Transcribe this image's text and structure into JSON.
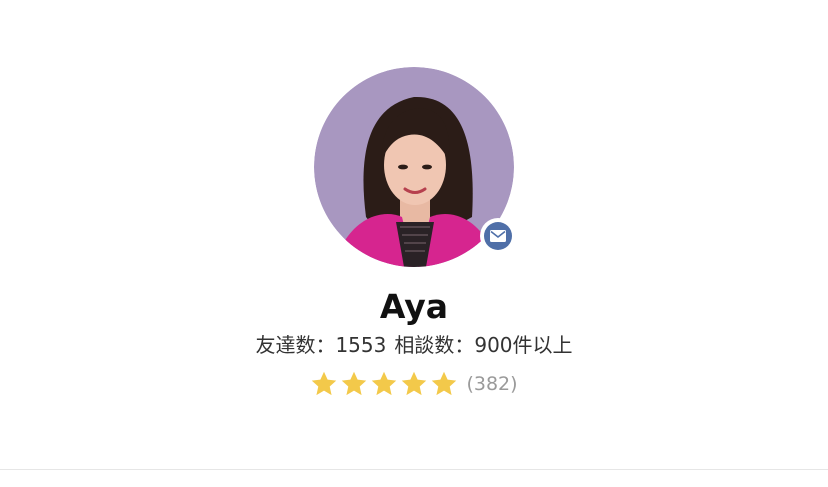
{
  "profile": {
    "name": "Aya",
    "friends_label": "友達数：",
    "friends_count": "1553",
    "consult_label": "相談数：",
    "consult_count": "900件以上",
    "rating_stars": 5,
    "rating_max": 5,
    "review_count": "(382)",
    "avatar_icon": "avatar-photo",
    "badge_icon": "mail-icon"
  },
  "colors": {
    "avatar_bg": "#a897c0",
    "badge": "#4f6fa8",
    "star": "#f3c94a",
    "jacket": "#d6258f"
  }
}
